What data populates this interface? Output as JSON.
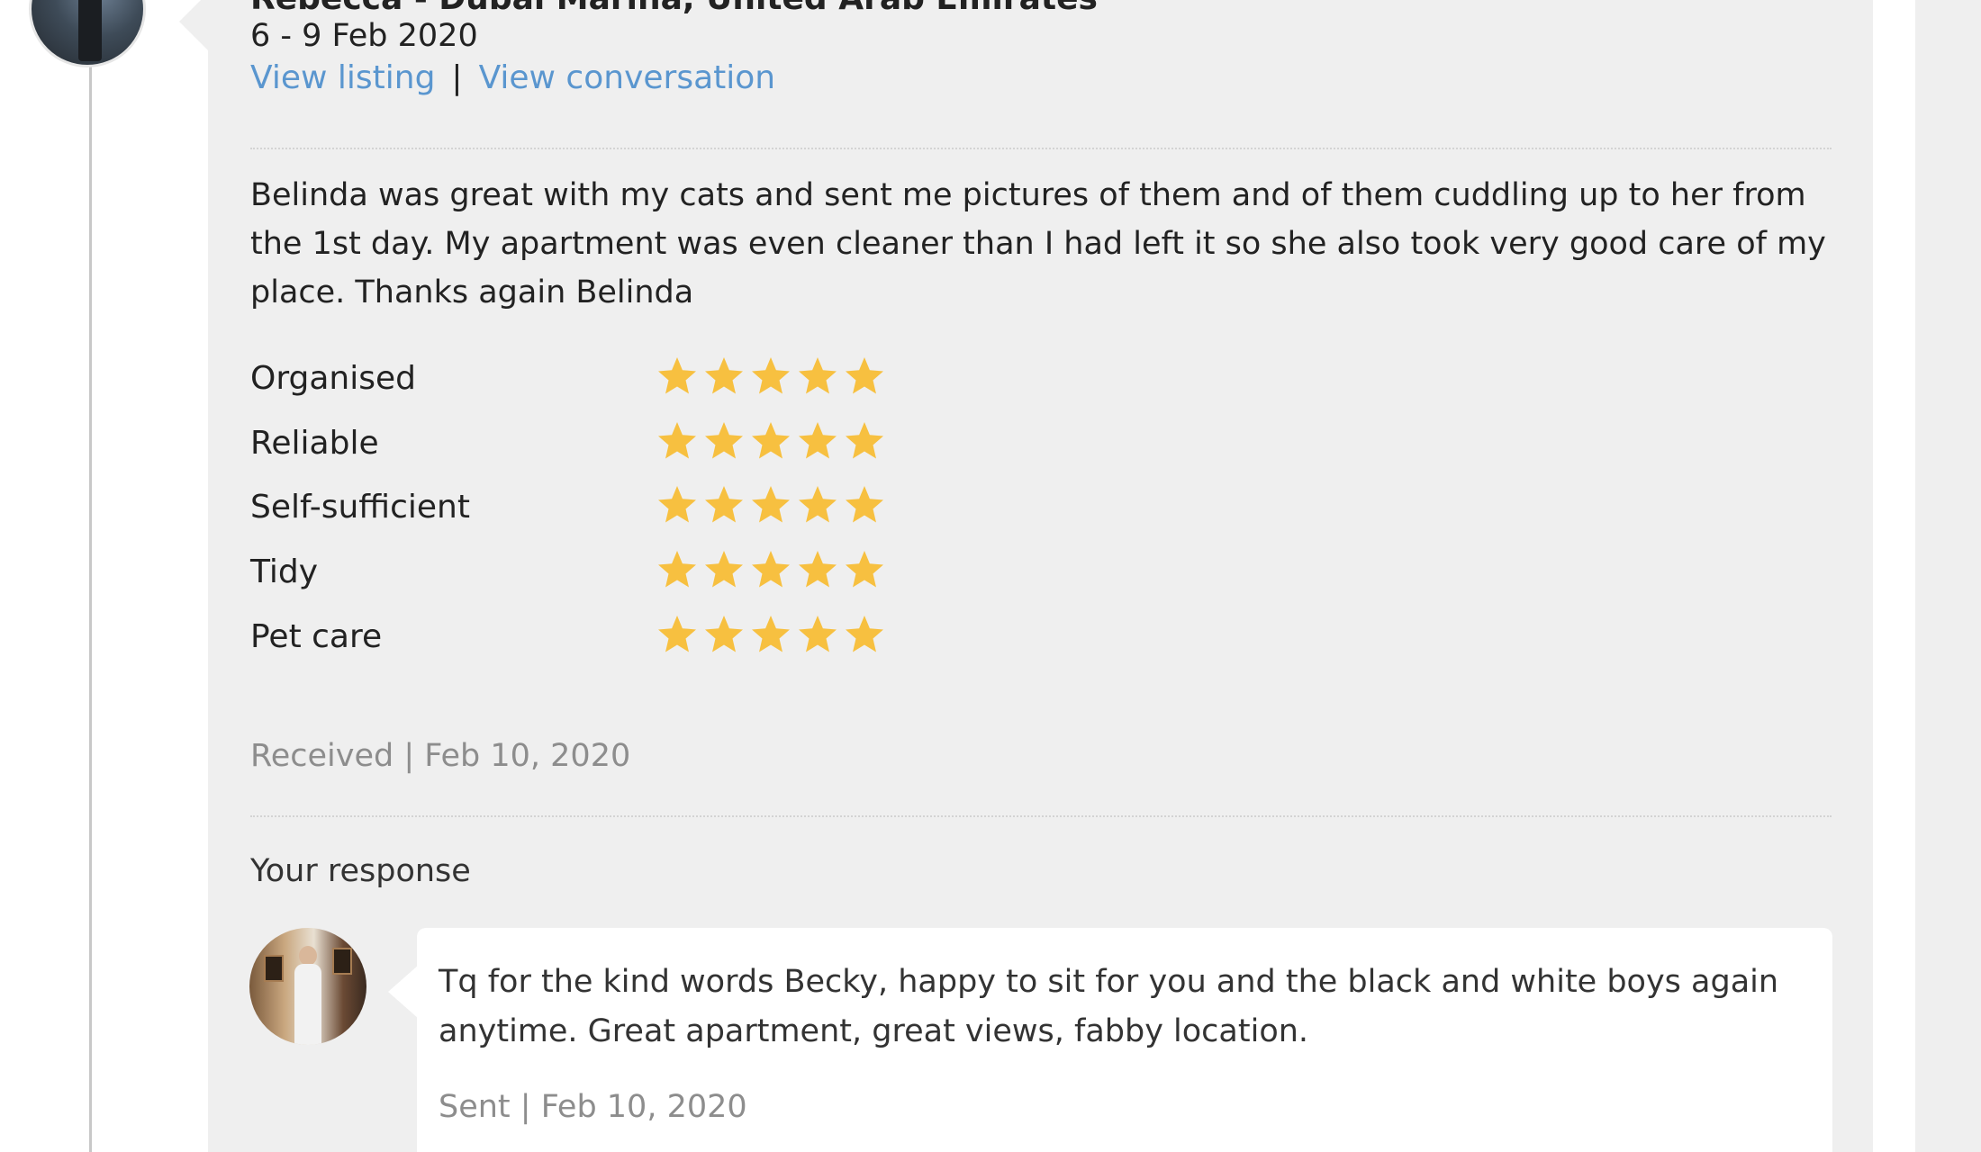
{
  "reviewer": {
    "name_location": "Rebecca - Dubai Marina, United Arab Emirates",
    "dates": "6 - 9 Feb 2020"
  },
  "links": {
    "view_listing": "View listing",
    "separator": "|",
    "view_conversation": "View conversation"
  },
  "review": {
    "text": "Belinda was great with my cats and sent me pictures of them and of them cuddling up to her from the 1st day. My apartment was even cleaner than I had left it so she also took very good care of my place. Thanks again Belinda",
    "received": "Received | Feb 10, 2020"
  },
  "ratings": [
    {
      "label": "Organised",
      "stars": 5,
      "max": 5
    },
    {
      "label": "Reliable",
      "stars": 5,
      "max": 5
    },
    {
      "label": "Self-sufficient",
      "stars": 5,
      "max": 5
    },
    {
      "label": "Tidy",
      "stars": 5,
      "max": 5
    },
    {
      "label": "Pet care",
      "stars": 5,
      "max": 5
    }
  ],
  "response": {
    "title": "Your response",
    "text": "Tq for the kind words Becky, happy to sit for you and the black and white boys again anytime. Great apartment, great views, fabby location.",
    "sent": "Sent | Feb 10, 2020"
  },
  "colors": {
    "card_bg": "#efefef",
    "link": "#5a96cf",
    "star": "#f7c040",
    "muted_text": "#8d8d8d"
  },
  "icons": {
    "close": "close-icon",
    "star": "star-icon"
  }
}
